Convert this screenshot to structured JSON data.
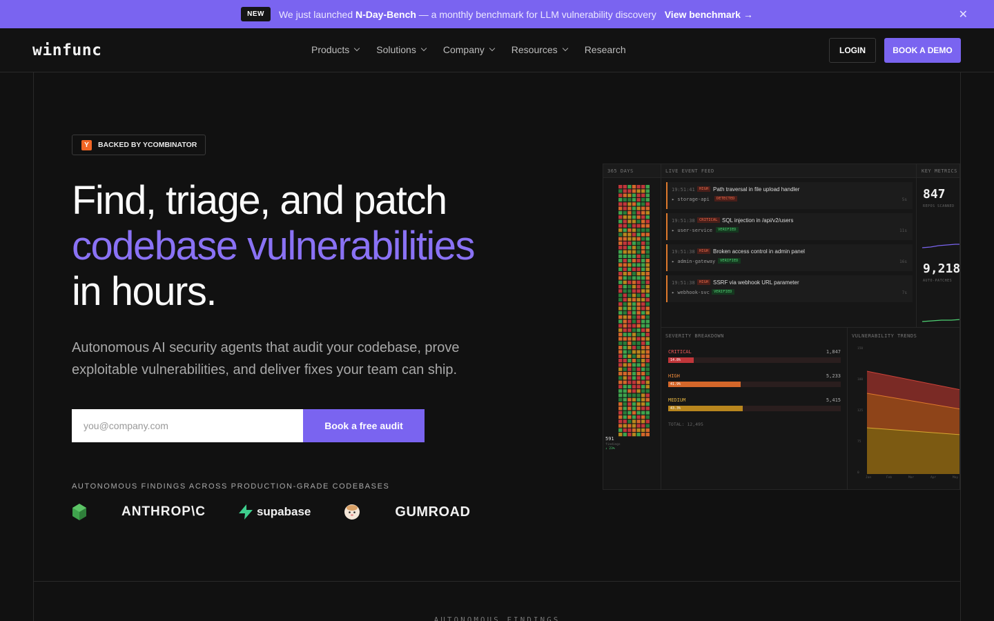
{
  "announcement": {
    "badge": "NEW",
    "message_prefix": "We just launched ",
    "message_bold": "N-Day-Bench",
    "message_suffix": " — a monthly benchmark for LLM vulnerability discovery",
    "link": "View benchmark",
    "close_icon": "close-icon"
  },
  "header": {
    "logo": "winfunc",
    "nav": [
      {
        "label": "Products",
        "has_dropdown": true
      },
      {
        "label": "Solutions",
        "has_dropdown": true
      },
      {
        "label": "Company",
        "has_dropdown": true
      },
      {
        "label": "Resources",
        "has_dropdown": true
      },
      {
        "label": "Research",
        "has_dropdown": false
      }
    ],
    "login": "LOGIN",
    "demo": "BOOK A DEMO"
  },
  "hero": {
    "yc_badge_icon": "Y",
    "yc_badge": "BACKED BY YCOMBINATOR",
    "title_line1": "Find, triage, and patch",
    "title_line2": "codebase vulnerabilities",
    "title_line3": "in hours.",
    "subtitle": "Autonomous AI security agents that audit your codebase, prove exploitable vulnerabilities, and deliver fixes your team can ship.",
    "email_placeholder": "you@company.com",
    "cta": "Book a free audit",
    "findings_label": "AUTONOMOUS FINDINGS ACROSS PRODUCTION-GRADE CODEBASES",
    "logos": [
      "ANTHROP\\C",
      "supabase",
      "GUMROAD"
    ],
    "logo_names": [
      "green-cube-logo",
      "anthropic-logo",
      "supabase-logo",
      "face-logo",
      "gumroad-logo"
    ]
  },
  "dashboard": {
    "left_head": "365 DAYS",
    "mid_head": "LIVE EVENT FEED",
    "right_head": "KEY METRICS",
    "heatmap_total": "591",
    "heatmap_sub": "findings",
    "heatmap_delta": "↓ 23%",
    "events": [
      {
        "time": "19:51:41",
        "sev": "HIGH",
        "title": "Path traversal in file upload handler",
        "svc": "▸ storage-api",
        "status": "DETECTED",
        "age": "5s"
      },
      {
        "time": "19:51:38",
        "sev": "CRITICAL",
        "title": "SQL injection in /api/v2/users",
        "svc": "▸ user-service",
        "status": "VERIFIED",
        "age": "11s"
      },
      {
        "time": "19:51:38",
        "sev": "HIGH",
        "title": "Broken access control in admin panel",
        "svc": "▸ admin-gateway",
        "status": "VERIFIED",
        "age": "16s"
      },
      {
        "time": "19:51:38",
        "sev": "HIGH",
        "title": "SSRF via webhook URL parameter",
        "svc": "▸ webhook-svc",
        "status": "VERIFIED",
        "age": "7s"
      }
    ],
    "metrics": [
      {
        "value": "847",
        "label": "REPOS SCANNED"
      },
      {
        "value": "9,218",
        "label": "AUTO-PATCHES"
      }
    ],
    "severity_head": "SEVERITY BREAKDOWN",
    "severity": [
      {
        "label": "CRITICAL",
        "value": "1,847",
        "pct_label": "14.8%",
        "pct": 0.148,
        "color": "#c0363a",
        "text_color": "#ef5a5a"
      },
      {
        "label": "HIGH",
        "value": "5,233",
        "pct_label": "41.9%",
        "pct": 0.419,
        "color": "#d4672a",
        "text_color": "#ef8a3a"
      },
      {
        "label": "MEDIUM",
        "value": "5,415",
        "pct_label": "43.3%",
        "pct": 0.433,
        "color": "#b8861e",
        "text_color": "#e0b040"
      }
    ],
    "total": "TOTAL: 12,495",
    "trends_head": "VULNERABILITY TRENDS",
    "trends_yticks": [
      "150",
      "100",
      "125",
      "75",
      "0"
    ],
    "trends_xticks": [
      "Jan",
      "Feb",
      "Mar",
      "Apr",
      "May"
    ]
  },
  "next_section": {
    "label": "AUTONOMOUS FINDINGS"
  },
  "colors": {
    "accent": "#7a64f0",
    "accent_text": "#8a72f5",
    "background": "#111111"
  }
}
